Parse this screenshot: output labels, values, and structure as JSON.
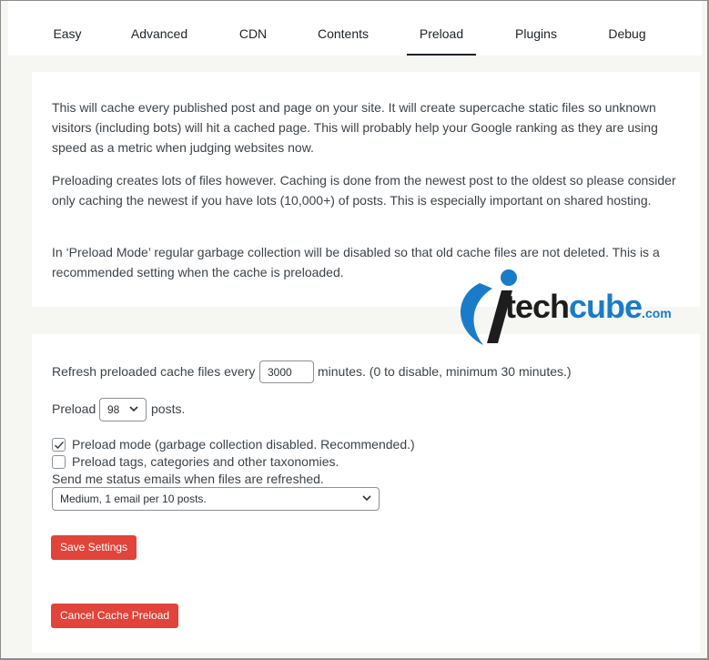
{
  "tabs": [
    {
      "label": "Easy",
      "active": false
    },
    {
      "label": "Advanced",
      "active": false
    },
    {
      "label": "CDN",
      "active": false
    },
    {
      "label": "Contents",
      "active": false
    },
    {
      "label": "Preload",
      "active": true
    },
    {
      "label": "Plugins",
      "active": false
    },
    {
      "label": "Debug",
      "active": false
    }
  ],
  "intro": {
    "p1": "This will cache every published post and page on your site. It will create supercache static files so unknown visitors (including bots) will hit a cached page. This will probably help your Google ranking as they are using speed as a metric when judging websites now.",
    "p2": "Preloading creates lots of files however. Caching is done from the newest post to the oldest so please consider only caching the newest if you have lots (10,000+) of posts. This is especially important on shared hosting.",
    "p3": "In ‘Preload Mode’ regular garbage collection will be disabled so that old cache files are not deleted. This is a recommended setting when the cache is preloaded."
  },
  "logo": {
    "part1": "tech",
    "part2": "cube",
    "part3": ".com",
    "accent_color": "#1a7cc8"
  },
  "settings": {
    "refresh_label_before": "Refresh preloaded cache files every",
    "refresh_value": "3000",
    "refresh_label_after": "minutes. (0 to disable, minimum 30 minutes.)",
    "preload_label_before": "Preload",
    "preload_value": "98",
    "preload_label_after": "posts.",
    "preload_mode_label": "Preload mode (garbage collection disabled. Recommended.)",
    "preload_mode_checked": true,
    "preload_tags_label": "Preload tags, categories and other taxonomies.",
    "preload_tags_checked": false,
    "email_label": "Send me status emails when files are refreshed.",
    "email_value": "Medium, 1 email per 10 posts.",
    "save_button": "Save Settings",
    "cancel_button": "Cancel Cache Preload",
    "button_color": "#e0443a"
  }
}
